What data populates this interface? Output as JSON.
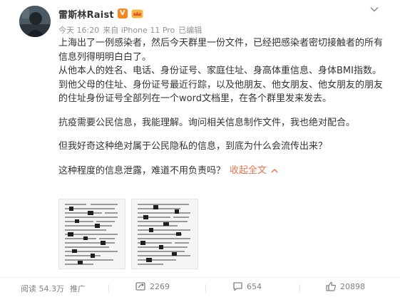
{
  "author": {
    "name": "雷斯林Raist",
    "vip_badge": "V",
    "badge_color": "#f7871b"
  },
  "meta": {
    "time": "今天 16:20",
    "source": "来自 iPhone 11 Pro",
    "edited": "已编辑"
  },
  "post": {
    "paragraphs": [
      "上海出了一例感染者，然后今天群里一份文件，已经把感染者密切接触者的所有信息列得明明白白了。",
      "从他本人的姓名、电话、身份证号、家庭住址、身高体重信息、身体BMI指数。到他父母的住址、身份证号最近行踪，以及他朋友、他女朋友、他女朋友的朋友的住址身份证号全部列在一个word文档里，在各个群里发来发去。"
    ],
    "paragraph_3": "抗疫需要公民信息，我能理解。询问相关信息制作文件，我也绝对配合。",
    "paragraph_4": "但我好奇这种绝对属于公民隐私的信息，到底为什么会流传出来？",
    "paragraph_5": "这种程度的信息泄露，难道不用负责吗？",
    "collapse_label": "收起全文",
    "link_color": "#eb7350"
  },
  "images": [
    {
      "icon": "document-screenshot"
    },
    {
      "icon": "document-screenshot"
    }
  ],
  "footer": {
    "views": "阅读 54.3万",
    "promote": "推广",
    "repost_count": "2269",
    "comment_count": "654",
    "like_count": "20898"
  }
}
